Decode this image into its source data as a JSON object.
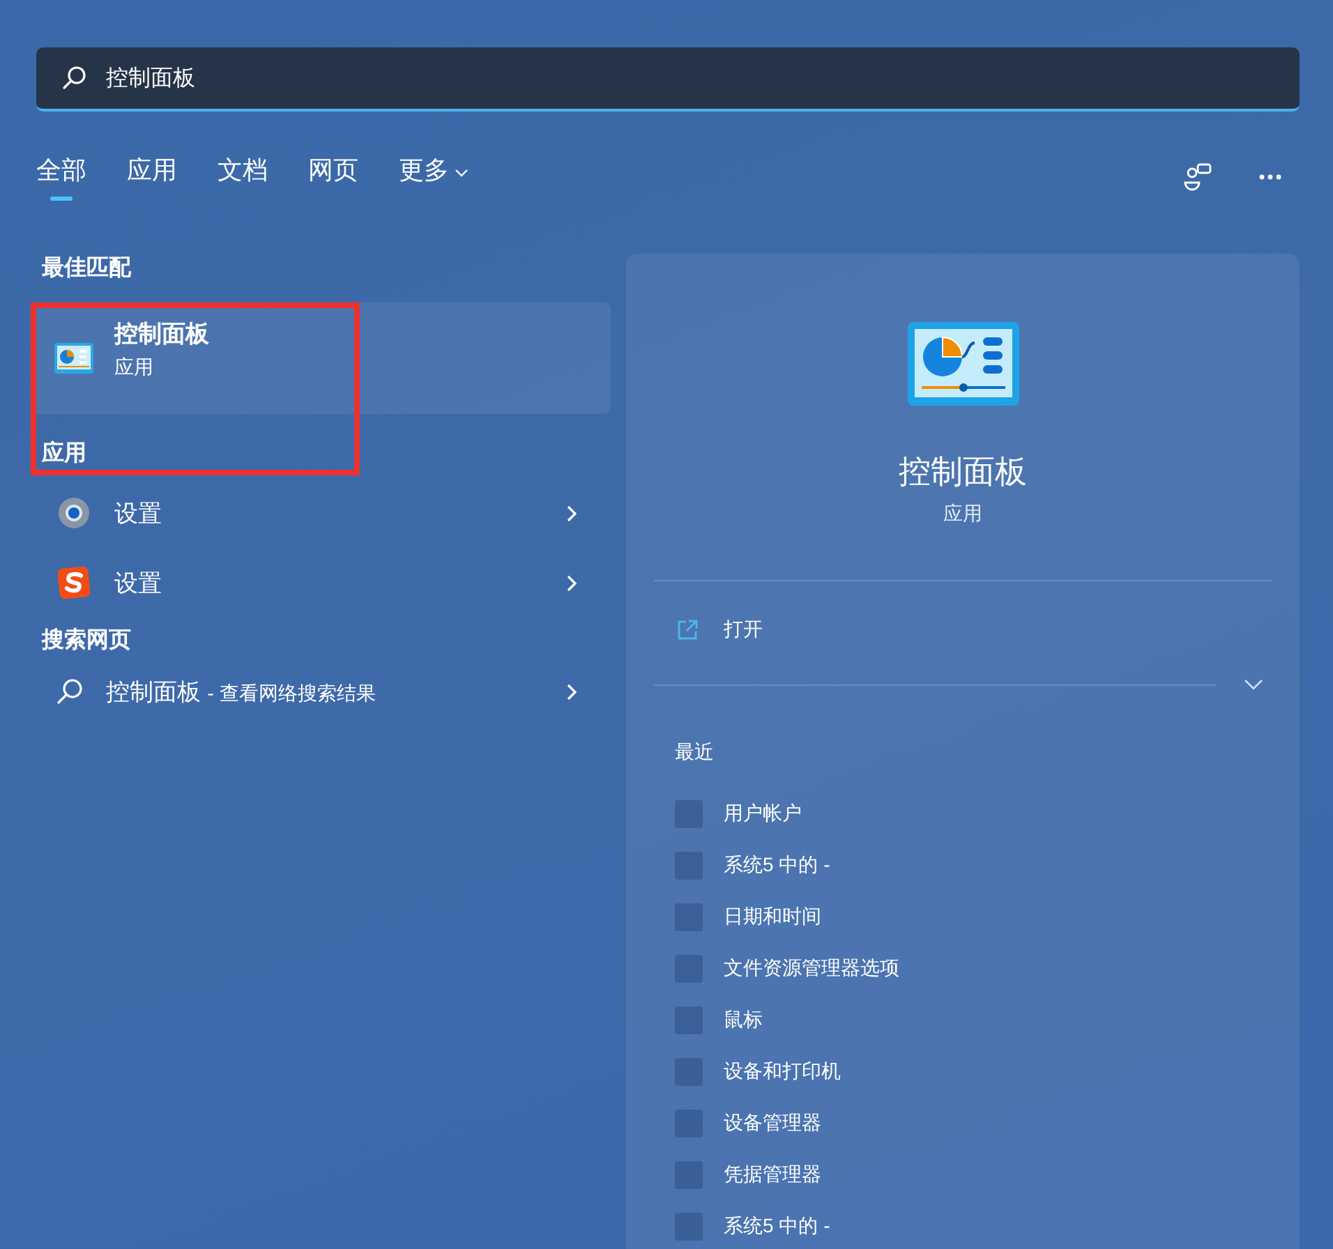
{
  "search": {
    "value": "控制面板"
  },
  "tabs": [
    {
      "label": "全部",
      "selected": true
    },
    {
      "label": "应用",
      "selected": false
    },
    {
      "label": "文档",
      "selected": false
    },
    {
      "label": "网页",
      "selected": false
    },
    {
      "label": "更多",
      "selected": false,
      "dropdown": true
    }
  ],
  "best_match": {
    "heading": "最佳匹配",
    "title": "控制面板",
    "subtitle": "应用",
    "selected": true
  },
  "apps": {
    "heading": "应用",
    "items": [
      {
        "kind": "gear",
        "label": "设置"
      },
      {
        "kind": "sogou",
        "label": "设置"
      }
    ]
  },
  "web": {
    "heading": "搜索网页",
    "items": [
      {
        "kind": "search",
        "label": "控制面板",
        "suffix": "- 查看网络搜索结果"
      }
    ]
  },
  "detail": {
    "title": "控制面板",
    "subtitle": "应用",
    "action": "打开",
    "recent_heading": "最近",
    "recent": [
      {
        "label": "用户帐户"
      },
      {
        "label": "系统5 中的 -"
      },
      {
        "label": "日期和时间"
      },
      {
        "label": "文件资源管理器选项"
      },
      {
        "label": "鼠标"
      },
      {
        "label": "设备和打印机"
      },
      {
        "label": "设备管理器"
      },
      {
        "label": "凭据管理器"
      },
      {
        "label": "系统5 中的 -"
      }
    ]
  }
}
